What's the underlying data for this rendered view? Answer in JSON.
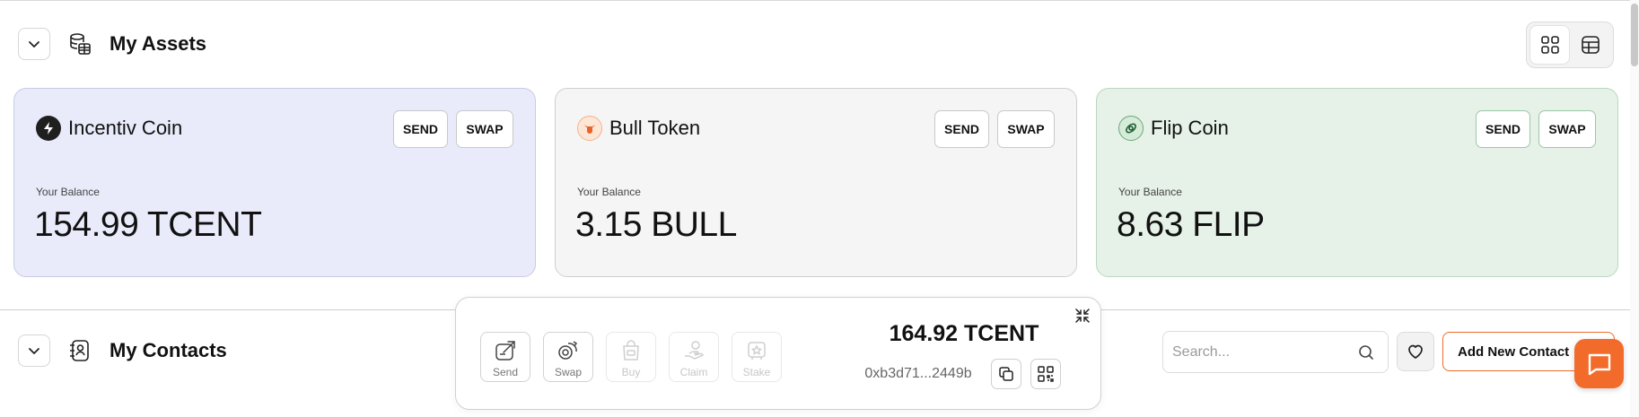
{
  "assets": {
    "title": "My Assets",
    "cards": [
      {
        "name": "Incentiv Coin",
        "send_label": "SEND",
        "swap_label": "SWAP",
        "balance_label": "Your Balance",
        "balance": "154.99 TCENT",
        "bg": "#e9ebfa",
        "icon": "incentiv-coin-icon"
      },
      {
        "name": "Bull Token",
        "send_label": "SEND",
        "swap_label": "SWAP",
        "balance_label": "Your Balance",
        "balance": "3.15 BULL",
        "bg": "#f5f5f5",
        "icon": "bull-token-icon"
      },
      {
        "name": "Flip Coin",
        "send_label": "SEND",
        "swap_label": "SWAP",
        "balance_label": "Your Balance",
        "balance": "8.63 FLIP",
        "bg": "#e6f1e8",
        "icon": "flip-coin-icon"
      }
    ]
  },
  "contacts": {
    "title": "My Contacts",
    "search_placeholder": "Search...",
    "add_label": "Add New Contact"
  },
  "wallet": {
    "actions": [
      {
        "label": "Send",
        "enabled": true
      },
      {
        "label": "Swap",
        "enabled": true
      },
      {
        "label": "Buy",
        "enabled": false
      },
      {
        "label": "Claim",
        "enabled": false
      },
      {
        "label": "Stake",
        "enabled": false
      }
    ],
    "balance": "164.92 TCENT",
    "address": "0xb3d71...2449b"
  },
  "colors": {
    "accent": "#f26b2a",
    "incentiv_bg": "#e9ebfa",
    "bull_bg": "#f5f5f5",
    "flip_bg": "#e6f1e8"
  }
}
